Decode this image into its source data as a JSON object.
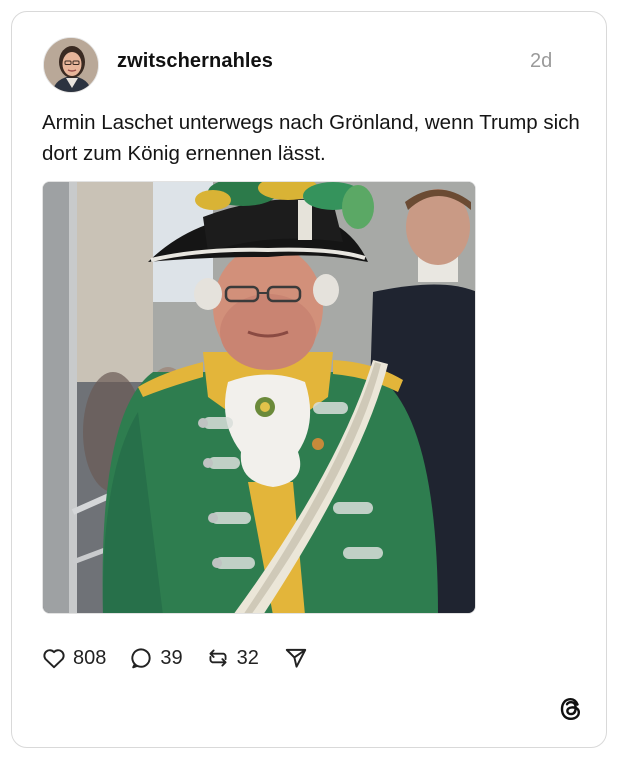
{
  "post": {
    "username": "zwitschernahles",
    "timestamp": "2d",
    "text": "Armin Laschet unterwegs nach Grönland, wenn Trump sich dort zum König ernennen lässt.",
    "likes": "808",
    "replies": "39",
    "reposts": "32"
  },
  "icons": {
    "like": "heart-icon",
    "reply": "comment-icon",
    "repost": "repost-icon",
    "share": "send-icon",
    "brand": "threads-logo-icon"
  },
  "colors": {
    "text": "#151515",
    "muted": "#9a9a9a",
    "border": "#d9d9d9",
    "coat_green": "#2e7d4f",
    "collar_yellow": "#e3b53a"
  }
}
